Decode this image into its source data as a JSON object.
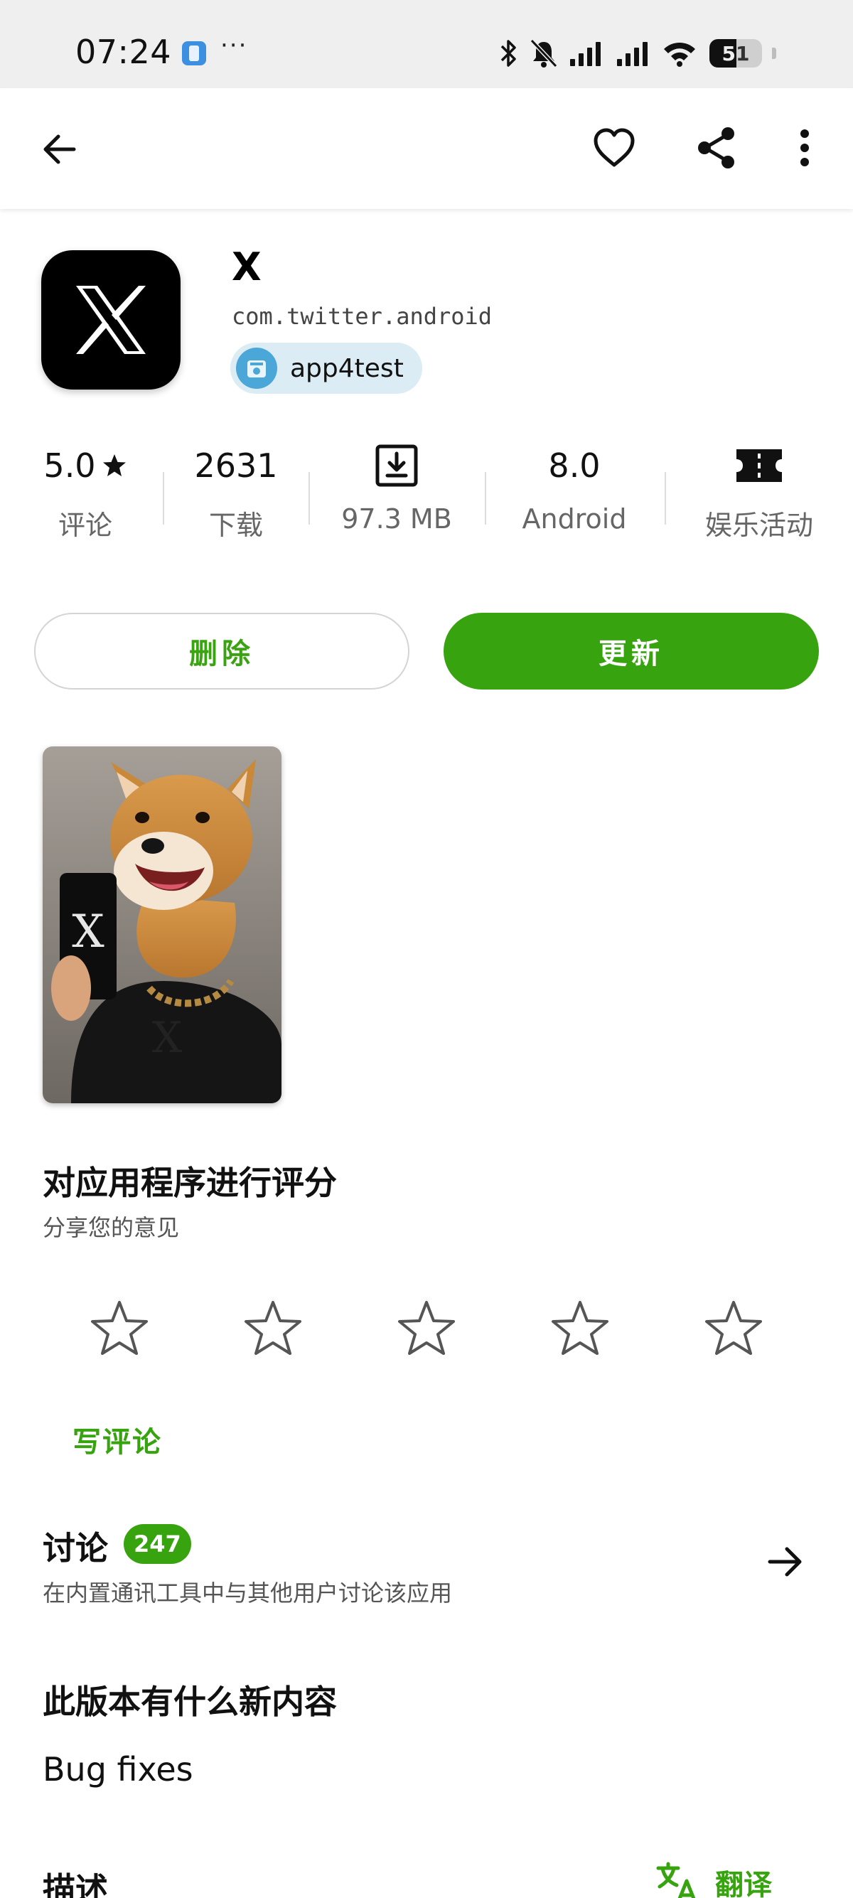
{
  "status_bar": {
    "time": "07:24",
    "more": "···",
    "battery": "51"
  },
  "app": {
    "name": "X",
    "package": "com.twitter.android",
    "uploader": "app4test"
  },
  "stats": {
    "rating": {
      "value": "5.0",
      "label": "评论"
    },
    "downloads": {
      "value": "2631",
      "label": "下载"
    },
    "size": {
      "label": "97.3 MB"
    },
    "android": {
      "value": "8.0",
      "label": "Android"
    },
    "category": {
      "label": "娱乐活动"
    }
  },
  "actions": {
    "delete_label": "删除",
    "update_label": "更新"
  },
  "rate_section": {
    "title": "对应用程序进行评分",
    "subtitle": "分享您的意见",
    "stars": 5,
    "rating_value": 0,
    "write_review": "写评论"
  },
  "discussion": {
    "title": "讨论",
    "count": "247",
    "subtitle": "在内置通讯工具中与其他用户讨论该应用"
  },
  "whats_new": {
    "title": "此版本有什么新内容",
    "text": "Bug fixes"
  },
  "description": {
    "title": "描述",
    "translate": "翻译"
  },
  "colors": {
    "accent": "#37a30e",
    "status_bar_bg": "#efefef",
    "chip_bg": "#dcecf4"
  }
}
